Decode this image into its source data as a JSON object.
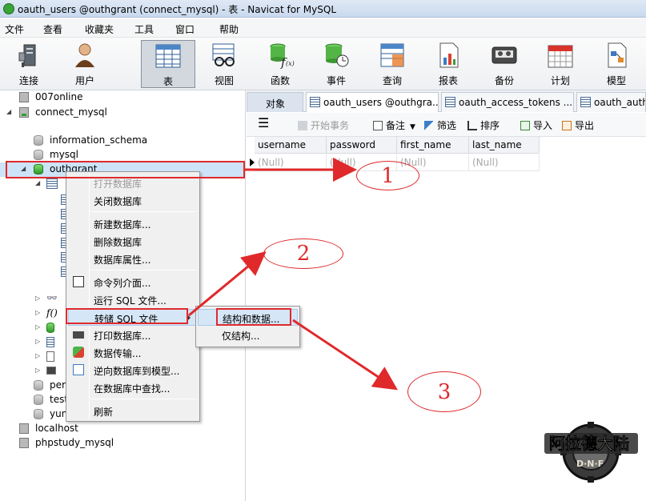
{
  "window": {
    "title": "oauth_users @outhgrant (connect_mysql) - 表 - Navicat for MySQL"
  },
  "menubar": [
    "文件",
    "查看",
    "收藏夹",
    "工具",
    "窗口",
    "帮助"
  ],
  "toolbar": [
    {
      "label": "连接",
      "icon": "connection-icon"
    },
    {
      "label": "用户",
      "icon": "user-icon"
    },
    {
      "label": "表",
      "icon": "table-icon"
    },
    {
      "label": "视图",
      "icon": "view-icon"
    },
    {
      "label": "函数",
      "icon": "function-icon"
    },
    {
      "label": "事件",
      "icon": "event-icon"
    },
    {
      "label": "查询",
      "icon": "query-icon"
    },
    {
      "label": "报表",
      "icon": "report-icon"
    },
    {
      "label": "备份",
      "icon": "backup-icon"
    },
    {
      "label": "计划",
      "icon": "schedule-icon"
    },
    {
      "label": "模型",
      "icon": "model-icon"
    }
  ],
  "tree": {
    "conn1": "007online",
    "conn2": "connect_mysql",
    "db1": "information_schema",
    "db2": "mysql",
    "db3": "outhgrant",
    "db4": "per",
    "db5": "test",
    "db6": "yun",
    "conn3": "localhost",
    "conn4": "phpstudy_mysql"
  },
  "tabs": {
    "object": "对象",
    "t1": "oauth_users @outhgra...",
    "t2": "oauth_access_tokens ...",
    "t3": "oauth_autho"
  },
  "subtoolbar": {
    "begin_tx": "开始事务",
    "note": "备注",
    "filter": "筛选",
    "sort": "排序",
    "import": "导入",
    "export": "导出"
  },
  "grid": {
    "columns": [
      "username",
      "password",
      "first_name",
      "last_name"
    ],
    "row": [
      "(Null)",
      "(Null)",
      "(Null)",
      "(Null)"
    ]
  },
  "context_menu": {
    "open_db": "打开数据库",
    "close_db": "关闭数据库",
    "new_db": "新建数据库...",
    "delete_db": "删除数据库",
    "db_props": "数据库属性...",
    "console": "命令列介面...",
    "run_sql": "运行 SQL 文件...",
    "dump_sql": "转储 SQL 文件",
    "print_db": "打印数据库...",
    "transfer": "数据传输...",
    "reverse": "逆向数据库到模型...",
    "find": "在数据库中查找...",
    "refresh": "刷新"
  },
  "submenu": {
    "structure_data": "结构和数据...",
    "structure_only": "仅结构..."
  },
  "annotations": [
    "1",
    "2",
    "3"
  ],
  "colors": {
    "annotation": "#e0292b",
    "highlight": "#d5e6f7",
    "null_text": "#a7a7a7"
  }
}
